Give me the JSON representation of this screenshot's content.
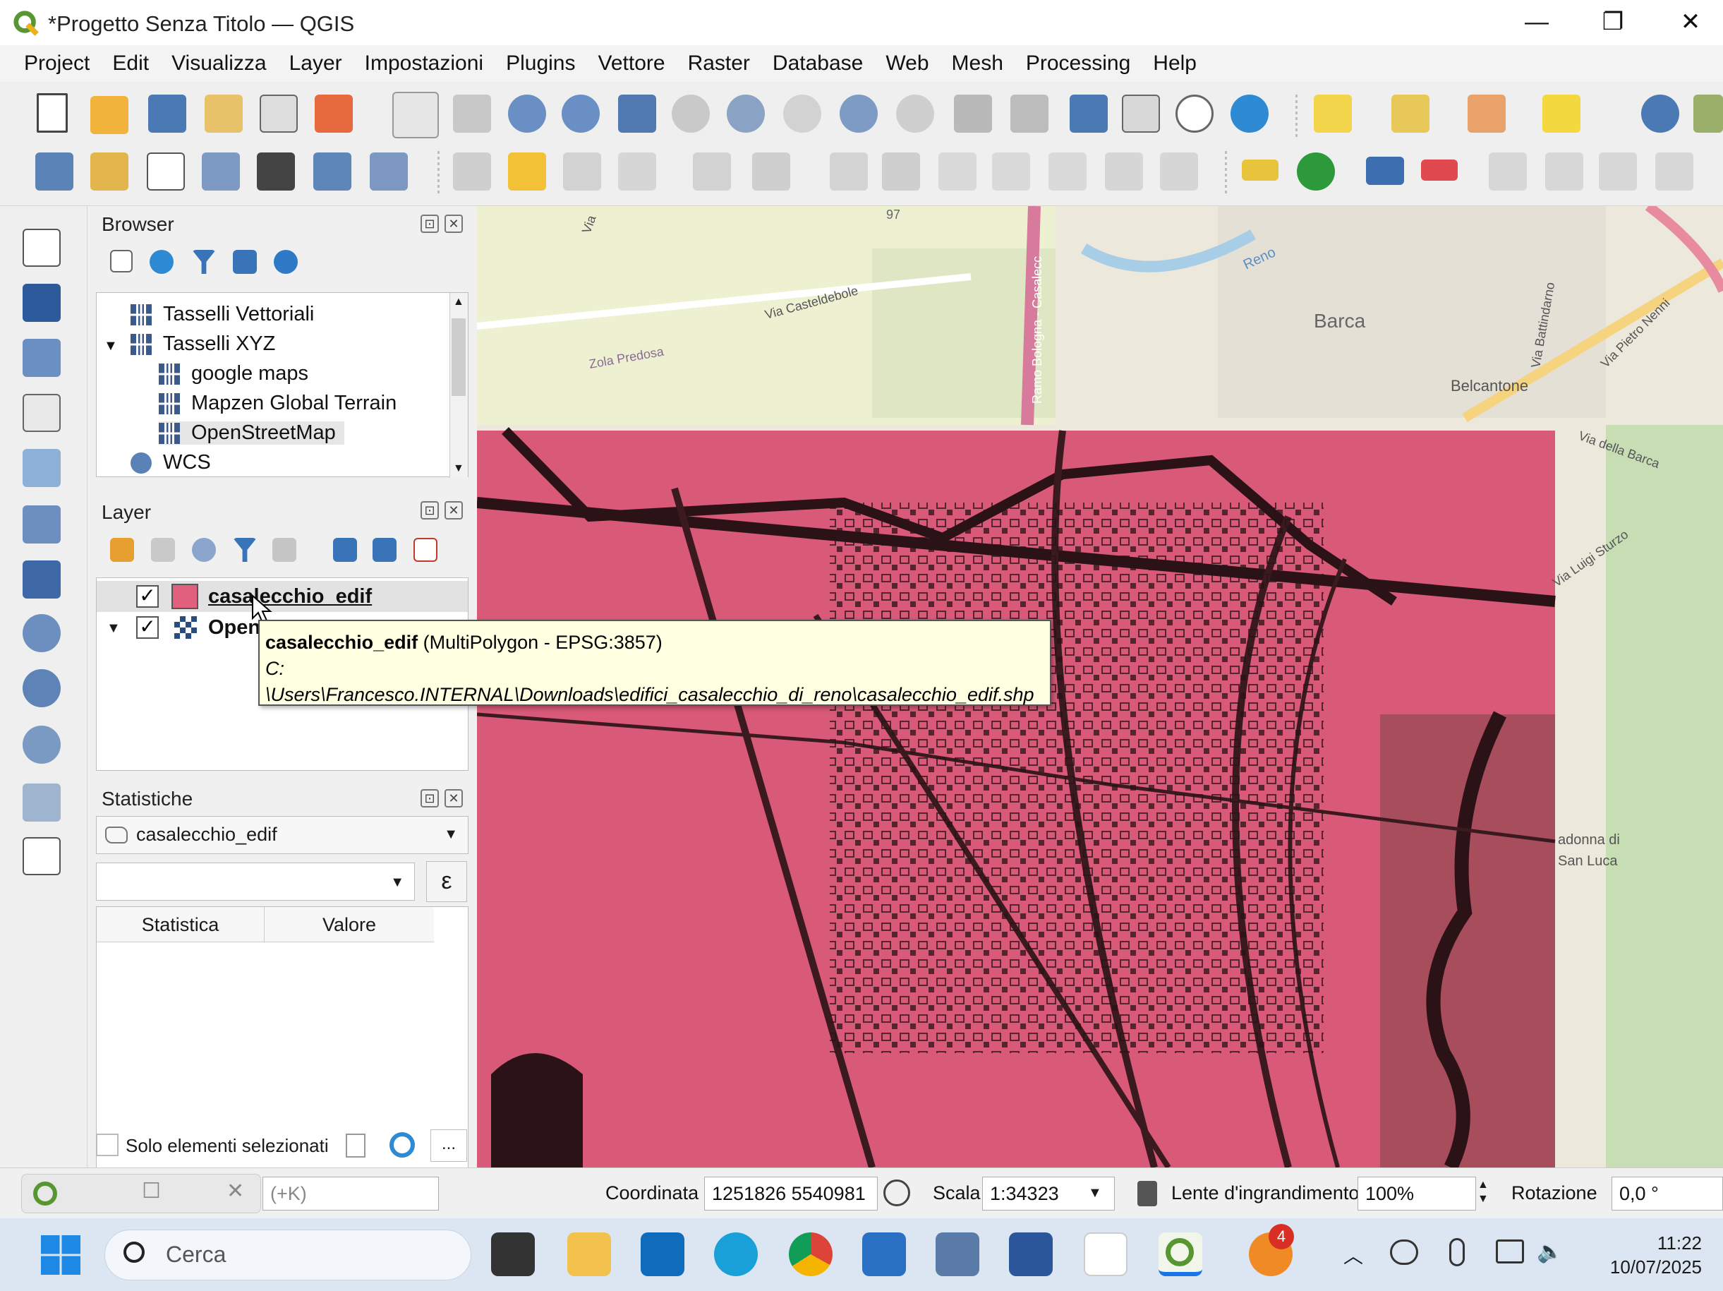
{
  "window": {
    "title": "*Progetto Senza Titolo — QGIS",
    "minimize": "—",
    "restore": "❐",
    "close": "✕"
  },
  "menu": [
    "Project",
    "Edit",
    "Visualizza",
    "Layer",
    "Impostazioni",
    "Plugins",
    "Vettore",
    "Raster",
    "Database",
    "Web",
    "Mesh",
    "Processing",
    "Help"
  ],
  "browser": {
    "title": "Browser",
    "items": [
      {
        "label": "Tasselli Vettoriali"
      },
      {
        "label": "Tasselli XYZ"
      },
      {
        "label": "google maps"
      },
      {
        "label": "Mapzen Global Terrain"
      },
      {
        "label": "OpenStreetMap"
      },
      {
        "label": "WCS"
      }
    ]
  },
  "layers": {
    "title": "Layer",
    "items": [
      {
        "label": "casalecchio_edif",
        "checked": "✓",
        "swatch": "#e0607e"
      },
      {
        "label": "Open",
        "checked": "✓"
      }
    ]
  },
  "tooltip": {
    "name": "casalecchio_edif",
    "info": " (MultiPolygon - EPSG:3857)",
    "line2": "C:",
    "line3": "\\Users\\Francesco.INTERNAL\\Downloads\\edifici_casalecchio_di_reno\\casalecchio_edif.shp"
  },
  "stats": {
    "title": "Statistiche",
    "layer": "casalecchio_edif",
    "expression_btn": "ε",
    "col_stat": "Statistica",
    "col_val": "Valore",
    "only_selected": "Solo elementi selezionati",
    "more_btn": "..."
  },
  "map": {
    "labels": [
      "Via Casteldebole",
      "Zola Predosa",
      "Barca",
      "Belcantone",
      "Reno",
      "Via Pietro Nenni",
      "Via Battindarno",
      "Ramo Bologna - Casalecc",
      "Via della Barca",
      "Via Luigi Sturzo",
      "adonna di",
      "San Luca",
      "97",
      "Via"
    ],
    "fill_color": "#d85a78",
    "line_color": "#3a1a1f"
  },
  "status": {
    "locator_hint": "(+K)",
    "coord_label": "Coordinata",
    "coord_value": "1251826 5540981",
    "scale_label": "Scala",
    "scale_value": "1:34323",
    "magnifier_label": "Lente d'ingrandimento",
    "magnifier_value": "100%",
    "rotation_label": "Rotazione",
    "rotation_value": "0,0 °"
  },
  "taskbar": {
    "search": "Cerca",
    "time": "11:22",
    "date": "10/07/2025",
    "badge": "4"
  }
}
